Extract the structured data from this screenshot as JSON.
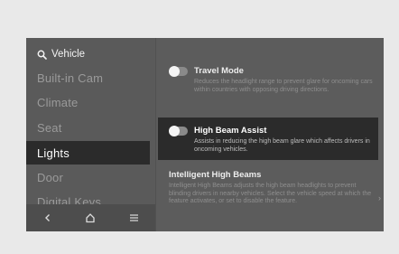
{
  "header": {
    "title": "Vehicle",
    "icon": "search-icon"
  },
  "sidebar": {
    "items": [
      {
        "label": "Built-in Cam"
      },
      {
        "label": "Climate"
      },
      {
        "label": "Seat"
      },
      {
        "label": "Lights",
        "active": true
      },
      {
        "label": "Door"
      },
      {
        "label": "Digital Keys"
      }
    ]
  },
  "bottom_nav": {
    "icons": [
      "back-icon",
      "home-icon",
      "menu-icon"
    ]
  },
  "settings": [
    {
      "title": "Travel Mode",
      "description": "Reduces the headlight range to prevent glare for oncoming cars within countries with opposing driving directions.",
      "toggle": "off"
    },
    {
      "title": "High Beam Assist",
      "description": "Assists in reducing the high beam glare which affects drivers in oncoming vehicles.",
      "toggle": "off",
      "highlighted": true
    },
    {
      "title": "Intelligent High Beams",
      "description": "Intelligent High Beams adjusts the high beam headlights to prevent blinding drivers in nearby vehicles. Select the vehicle speed at which the feature activates, or set to disable the feature."
    }
  ],
  "colors": {
    "screen_bg": "#5c5c5c",
    "highlight_bg": "#2b2b2b",
    "page_bg": "#e9e9e9"
  }
}
